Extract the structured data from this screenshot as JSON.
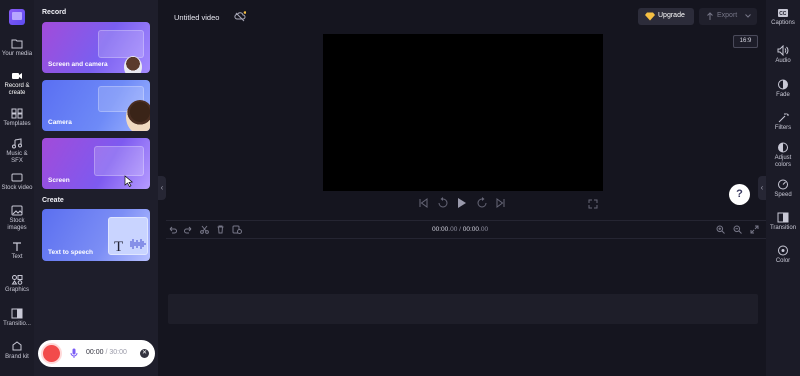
{
  "leftnav": {
    "items": [
      {
        "label": "Your media",
        "icon": "folder-icon"
      },
      {
        "label": "Record & create",
        "icon": "camera-icon"
      },
      {
        "label": "Templates",
        "icon": "templates-icon"
      },
      {
        "label": "Music & SFX",
        "icon": "music-icon"
      },
      {
        "label": "Stock video",
        "icon": "stock-video-icon"
      },
      {
        "label": "Stock images",
        "icon": "stock-images-icon"
      },
      {
        "label": "Text",
        "icon": "text-icon"
      },
      {
        "label": "Graphics",
        "icon": "graphics-icon"
      },
      {
        "label": "Transitio...",
        "icon": "transitions-icon"
      },
      {
        "label": "Brand kit",
        "icon": "brand-kit-icon"
      }
    ]
  },
  "panel": {
    "record_heading": "Record",
    "create_heading": "Create",
    "cards": {
      "screen_camera": "Screen and camera",
      "camera": "Camera",
      "screen": "Screen",
      "tts": "Text to speech"
    }
  },
  "recorder": {
    "elapsed": "00:00",
    "limit": "/ 30:00"
  },
  "topbar": {
    "title": "Untitled video",
    "upgrade_label": "Upgrade",
    "export_label": "Export"
  },
  "preview": {
    "aspect_ratio": "16:9"
  },
  "timeline": {
    "current": "00:00",
    "current_frac": ".00",
    "total": "00:00",
    "total_frac": ".00",
    "separator": " / "
  },
  "rightrail": {
    "items": [
      {
        "label": "Captions",
        "icon": "captions-icon"
      },
      {
        "label": "Audio",
        "icon": "audio-icon"
      },
      {
        "label": "Fade",
        "icon": "fade-icon"
      },
      {
        "label": "Filters",
        "icon": "filters-icon"
      },
      {
        "label": "Adjust colors",
        "icon": "adjust-colors-icon"
      },
      {
        "label": "Speed",
        "icon": "speed-icon"
      },
      {
        "label": "Transition",
        "icon": "transition-icon"
      },
      {
        "label": "Color",
        "icon": "color-icon"
      }
    ]
  },
  "help": {
    "label": "?"
  },
  "colors": {
    "accent": "#7b5cf6",
    "record": "#f24b4b",
    "background": "#15151f",
    "panel": "#1e1e2b"
  }
}
